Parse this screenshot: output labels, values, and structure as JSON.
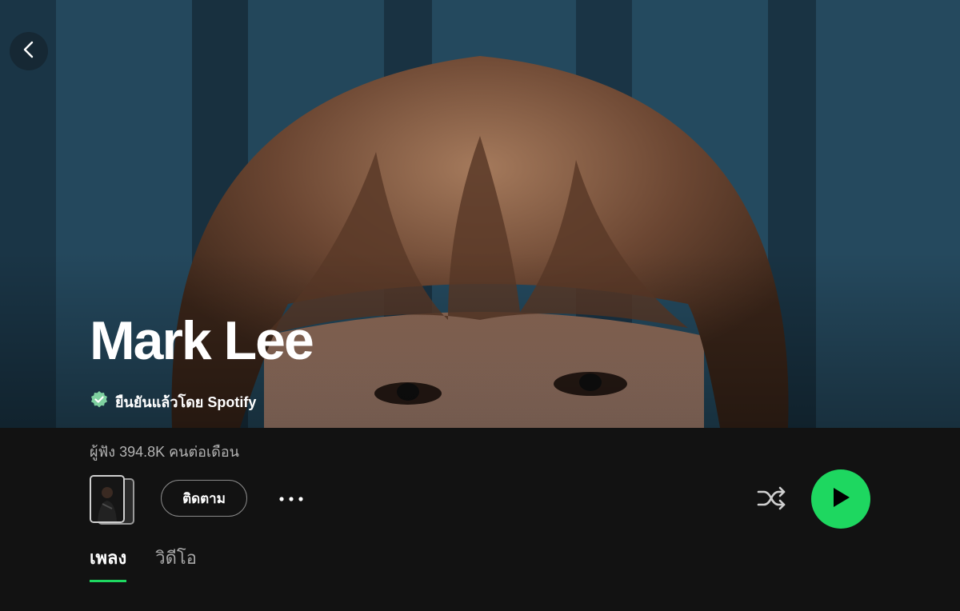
{
  "hero": {
    "artist_name": "Mark Lee",
    "verified_label": "ยืนยันแล้วโดย Spotify",
    "background_color": "#1e3f52"
  },
  "stats": {
    "monthly_listeners": "ผู้ฟัง 394.8K คนต่อเดือน"
  },
  "actions": {
    "follow_label": "ติดตาม",
    "more_icon": "more-horizontal-icon",
    "shuffle_icon": "shuffle-icon",
    "play_icon": "play-icon",
    "back_icon": "chevron-left-icon"
  },
  "tabs": [
    {
      "label": "เพลง",
      "active": true
    },
    {
      "label": "วิดีโอ",
      "active": false
    }
  ],
  "colors": {
    "accent": "#1ed760",
    "background": "#121212",
    "secondary_text": "#b3b3b3"
  }
}
